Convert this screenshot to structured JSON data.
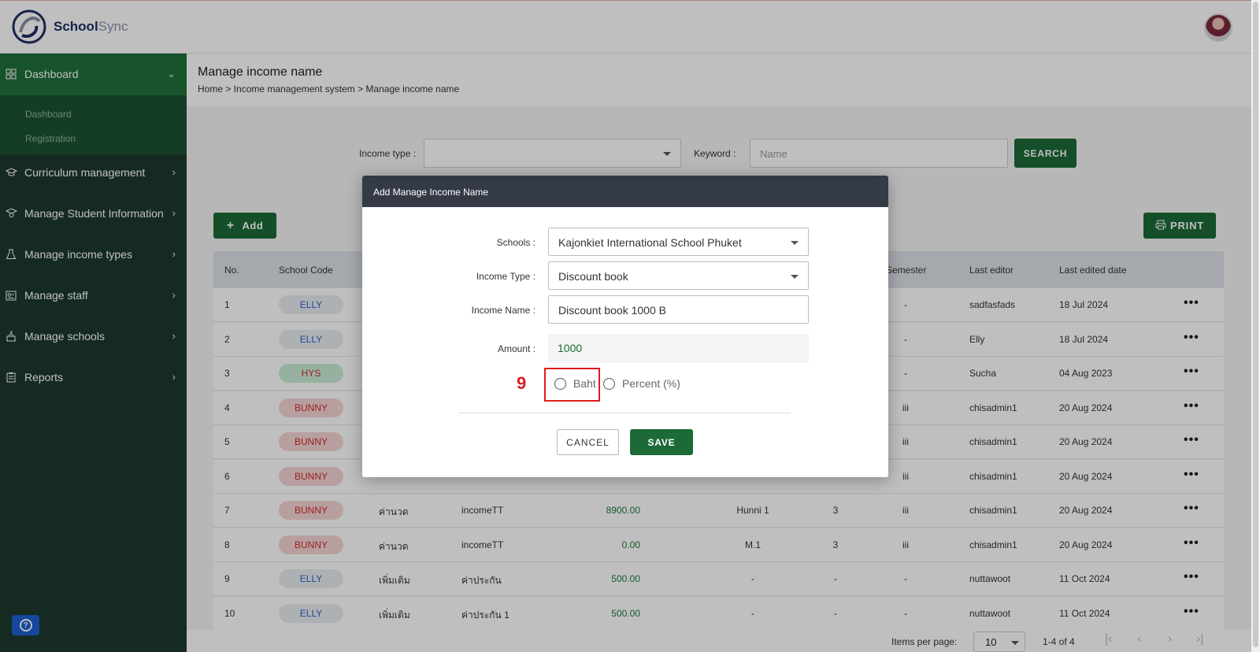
{
  "app": {
    "brand_main": "School",
    "brand_sub": "Sync"
  },
  "sidebar": {
    "items": [
      {
        "label": "Dashboard",
        "icon": "grid-icon"
      },
      {
        "label": "Curriculum management",
        "icon": "graduation-cap-icon"
      },
      {
        "label": "Manage Student Information",
        "icon": "student-icon"
      },
      {
        "label": "Manage income types",
        "icon": "flask-icon"
      },
      {
        "label": "Manage staff",
        "icon": "id-card-icon"
      },
      {
        "label": "Manage schools",
        "icon": "school-icon"
      },
      {
        "label": "Reports",
        "icon": "clipboard-icon"
      }
    ],
    "sub_items": [
      "Dashboard",
      "Registration"
    ]
  },
  "page": {
    "title": "Manage income name",
    "breadcrumb": "Home > Income management system > Manage income name"
  },
  "filters": {
    "income_type_label": "Income type :",
    "keyword_label": "Keyword :",
    "keyword_placeholder": "Name",
    "search_button": "SEARCH"
  },
  "actions": {
    "add_button": "Add",
    "print_button": "PRINT"
  },
  "table": {
    "headers": [
      "No.",
      "School Code",
      "Semester",
      "Last editor",
      "Last edited date"
    ],
    "rows": [
      {
        "no": "1",
        "code": "ELLY",
        "col3": "",
        "col4": "",
        "amount": "",
        "col6": "",
        "col7": "",
        "semester": "-",
        "editor": "sadfasfads",
        "date": "18 Jul 2024"
      },
      {
        "no": "2",
        "code": "ELLY",
        "col3": "",
        "col4": "",
        "amount": "",
        "col6": "",
        "col7": "",
        "semester": "-",
        "editor": "Elly",
        "date": "18 Jul 2024"
      },
      {
        "no": "3",
        "code": "HYS",
        "col3": "",
        "col4": "",
        "amount": "",
        "col6": "",
        "col7": "",
        "semester": "-",
        "editor": "Sucha",
        "date": "04 Aug 2023"
      },
      {
        "no": "4",
        "code": "BUNNY",
        "col3": "",
        "col4": "",
        "amount": "",
        "col6": "",
        "col7": "",
        "semester": "iii",
        "editor": "chisadmin1",
        "date": "20 Aug 2024"
      },
      {
        "no": "5",
        "code": "BUNNY",
        "col3": "",
        "col4": "",
        "amount": "",
        "col6": "",
        "col7": "",
        "semester": "iii",
        "editor": "chisadmin1",
        "date": "20 Aug 2024"
      },
      {
        "no": "6",
        "code": "BUNNY",
        "col3": "",
        "col4": "",
        "amount": "",
        "col6": "",
        "col7": "",
        "semester": "iii",
        "editor": "chisadmin1",
        "date": "20 Aug 2024"
      },
      {
        "no": "7",
        "code": "BUNNY",
        "col3": "ค่านวด",
        "col4": "incomeTT",
        "amount": "8900.00",
        "col6": "Hunni 1",
        "col7": "3",
        "semester": "iii",
        "editor": "chisadmin1",
        "date": "20 Aug 2024"
      },
      {
        "no": "8",
        "code": "BUNNY",
        "col3": "ค่านวด",
        "col4": "incomeTT",
        "amount": "0.00",
        "col6": "M.1",
        "col7": "3",
        "semester": "iii",
        "editor": "chisadmin1",
        "date": "20 Aug 2024"
      },
      {
        "no": "9",
        "code": "ELLY",
        "col3": "เพิ่มเติม",
        "col4": "ค่าประกัน",
        "amount": "500.00",
        "col6": "-",
        "col7": "-",
        "semester": "-",
        "editor": "nuttawoot",
        "date": "11 Oct 2024"
      },
      {
        "no": "10",
        "code": "ELLY",
        "col3": "เพิ่มเติม",
        "col4": "ค่าประกัน 1",
        "amount": "500.00",
        "col6": "-",
        "col7": "-",
        "semester": "-",
        "editor": "nuttawoot",
        "date": "11 Oct 2024"
      }
    ]
  },
  "pagination": {
    "items_per_page_label": "Items per page:",
    "items_per_page": "10",
    "range": "1-4 of 4"
  },
  "modal": {
    "title": "Add Manage Income Name",
    "schools_label": "Schools :",
    "schools_value": "Kajonkiet International School Phuket",
    "income_type_label": "Income Type :",
    "income_type_value": "Discount book",
    "income_name_label": "Income Name :",
    "income_name_value": "Discount book 1000 B",
    "amount_label": "Amount :",
    "amount_value": "1000",
    "radio_baht": "Baht",
    "radio_percent": "Percent (%)",
    "annotation_number": "9",
    "cancel_button": "CANCEL",
    "save_button": "SAVE"
  },
  "colors": {
    "primary": "#1b6a37",
    "sidebar": "#1d3a2d",
    "sidebar_active": "#1f6f3a",
    "modal_header": "#343a46",
    "annotation": "#e01b1b"
  }
}
